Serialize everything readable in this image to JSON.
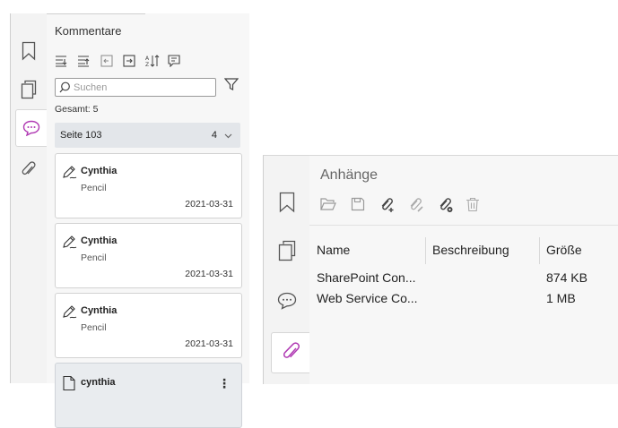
{
  "comments_panel": {
    "title": "Kommentare",
    "search": {
      "placeholder": "Suchen"
    },
    "total_label": "Gesamt: 5",
    "group": {
      "label": "Seite 103",
      "count": "4"
    },
    "cards": [
      {
        "author": "Cynthia",
        "type": "Pencil",
        "date": "2021-03-31"
      },
      {
        "author": "Cynthia",
        "type": "Pencil",
        "date": "2021-03-31"
      },
      {
        "author": "Cynthia",
        "type": "Pencil",
        "date": "2021-03-31"
      },
      {
        "author": "cynthia"
      }
    ],
    "rail_icons": [
      "bookmark-icon",
      "pages-icon",
      "comment-icon",
      "paperclip-icon"
    ],
    "toolbar_icons": [
      "expand-all-icon",
      "collapse-all-icon",
      "import-icon",
      "export-icon",
      "sort-icon",
      "summarize-icon"
    ],
    "accent_color": "#b03ab3"
  },
  "attachments_panel": {
    "title": "Anhänge",
    "toolbar_icons": [
      "open-folder-icon",
      "save-icon",
      "add-attachment-icon",
      "edit-attachment-icon",
      "attachment-settings-icon",
      "delete-icon"
    ],
    "columns": [
      "Name",
      "Beschreibung",
      "Größe"
    ],
    "rows": [
      {
        "name": "SharePoint Con...",
        "description": "",
        "size": "874 KB"
      },
      {
        "name": "Web Service Co...",
        "description": "",
        "size": "1 MB"
      }
    ],
    "rail_icons": [
      "bookmark-icon",
      "pages-icon",
      "comment-icon",
      "paperclip-icon"
    ],
    "accent_color": "#b03ab3"
  }
}
